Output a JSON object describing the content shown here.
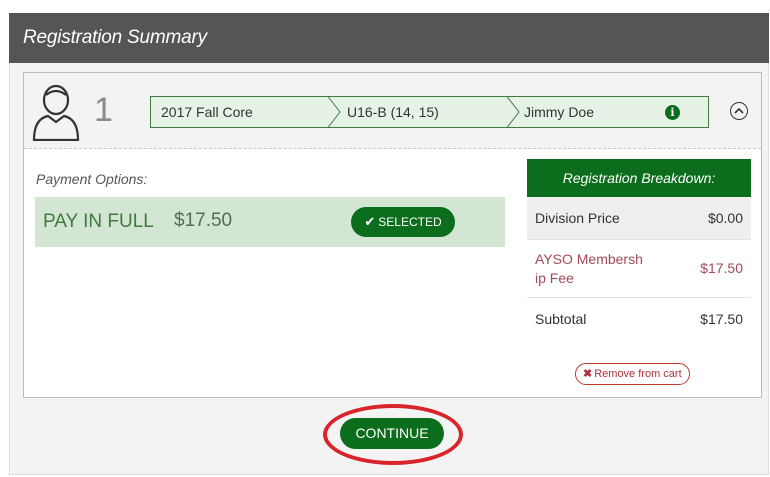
{
  "header": {
    "title": "Registration Summary"
  },
  "registration": {
    "number": "1",
    "breadcrumb": [
      "2017 Fall Core",
      "U16-B (14, 15)",
      "Jimmy Doe"
    ]
  },
  "payment": {
    "label": "Payment Options:",
    "option_name": "PAY IN FULL",
    "option_price": "$17.50",
    "selected_label": "SELECTED"
  },
  "breakdown": {
    "title": "Registration Breakdown:",
    "rows": [
      {
        "label": "Division Price",
        "value": "$0.00"
      },
      {
        "label": "AYSO Membersh ip Fee",
        "value": "$17.50"
      },
      {
        "label": "Subtotal",
        "value": "$17.50"
      }
    ]
  },
  "actions": {
    "remove_label": "Remove from cart",
    "continue_label": "CONTINUE"
  },
  "colors": {
    "brand_green": "#0c6e1d",
    "header_gray": "#555555",
    "highlight_red": "#d8242a"
  }
}
